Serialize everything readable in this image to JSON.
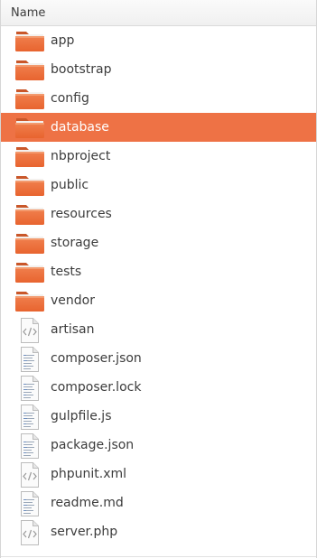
{
  "header": {
    "name_label": "Name"
  },
  "colors": {
    "selection": "#ee7245",
    "folder_top": "#f07f4d",
    "folder_body": "#e8642f"
  },
  "items": [
    {
      "label": "app",
      "kind": "folder",
      "icon": "folder-icon",
      "selected": false
    },
    {
      "label": "bootstrap",
      "kind": "folder",
      "icon": "folder-icon",
      "selected": false
    },
    {
      "label": "config",
      "kind": "folder",
      "icon": "folder-icon",
      "selected": false
    },
    {
      "label": "database",
      "kind": "folder",
      "icon": "folder-icon",
      "selected": true
    },
    {
      "label": "nbproject",
      "kind": "folder",
      "icon": "folder-icon",
      "selected": false
    },
    {
      "label": "public",
      "kind": "folder",
      "icon": "folder-icon",
      "selected": false
    },
    {
      "label": "resources",
      "kind": "folder",
      "icon": "folder-icon",
      "selected": false
    },
    {
      "label": "storage",
      "kind": "folder",
      "icon": "folder-icon",
      "selected": false
    },
    {
      "label": "tests",
      "kind": "folder",
      "icon": "folder-icon",
      "selected": false
    },
    {
      "label": "vendor",
      "kind": "folder",
      "icon": "folder-icon",
      "selected": false
    },
    {
      "label": "artisan",
      "kind": "file",
      "icon": "code-file-icon",
      "selected": false
    },
    {
      "label": "composer.json",
      "kind": "file",
      "icon": "text-file-icon",
      "selected": false
    },
    {
      "label": "composer.lock",
      "kind": "file",
      "icon": "text-file-icon",
      "selected": false
    },
    {
      "label": "gulpfile.js",
      "kind": "file",
      "icon": "text-file-icon",
      "selected": false
    },
    {
      "label": "package.json",
      "kind": "file",
      "icon": "text-file-icon",
      "selected": false
    },
    {
      "label": "phpunit.xml",
      "kind": "file",
      "icon": "code-file-icon",
      "selected": false
    },
    {
      "label": "readme.md",
      "kind": "file",
      "icon": "text-file-icon",
      "selected": false
    },
    {
      "label": "server.php",
      "kind": "file",
      "icon": "code-file-icon",
      "selected": false
    }
  ]
}
